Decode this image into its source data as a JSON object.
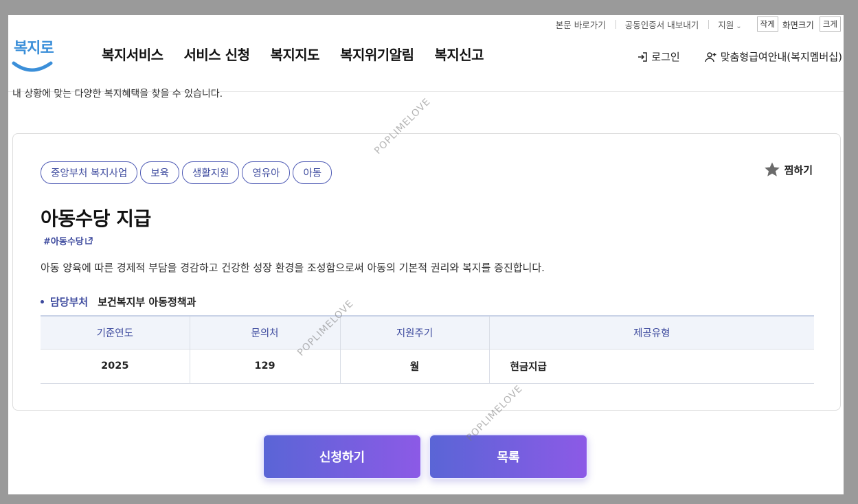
{
  "utility": {
    "skip_link": "본문 바로가기",
    "cert_export": "공동인증서 내보내기",
    "support": "지원",
    "size_small": "작게",
    "size_label": "화면크기",
    "size_large": "크게"
  },
  "header": {
    "logo_text": "복지로",
    "nav": [
      "복지서비스",
      "서비스 신청",
      "복지지도",
      "복지위기알림",
      "복지신고"
    ],
    "login": "로그인",
    "membership": "맞춤형급여안내(복지멤버십)"
  },
  "intro_text": "내 상황에 맞는 다양한 복지혜택을 찾을 수 있습니다.",
  "card": {
    "tags": [
      "중앙부처 복지사업",
      "보육",
      "생활지원",
      "영유아",
      "아동"
    ],
    "bookmark": "찜하기",
    "title": "아동수당 지급",
    "hashtag": "#아동수당",
    "description": "아동 양육에 따른 경제적 부담을 경감하고 건강한 성장 환경을 조성함으로써 아동의 기본적 권리와 복지를 증진합니다.",
    "dept_label": "담당부처",
    "dept_value": "보건복지부 아동정책과",
    "table": {
      "headers": [
        "기준연도",
        "문의처",
        "지원주기",
        "제공유형"
      ],
      "row": [
        "2025",
        "129",
        "월",
        "현금지급"
      ]
    }
  },
  "buttons": {
    "apply": "신청하기",
    "list": "목록"
  },
  "watermark": "POPLIMELOVE",
  "colors": {
    "accent": "#3d4a9e",
    "button_start": "#5a65d6",
    "button_end": "#8c5ae6",
    "logo": "#3b8fd9"
  }
}
